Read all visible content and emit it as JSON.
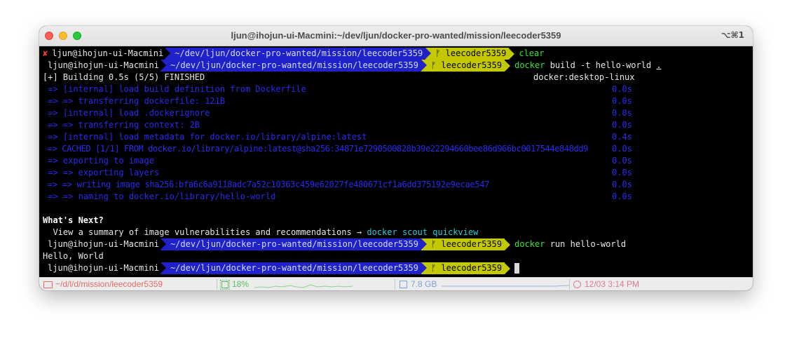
{
  "window": {
    "title": "ljun@ihojun-ui-Macmini:~/dev/ljun/docker-pro-wanted/mission/leecoder5359",
    "shortcut": "⌥⌘1"
  },
  "prompt": {
    "context": "ljun@ihojun-ui-Macmini",
    "path": "~/dev/ljun/docker-pro-wanted/mission/leecoder5359",
    "branch": "leecoder5359",
    "branch_icon": "git-branch-icon",
    "error_mark": "✘"
  },
  "lines": {
    "l1_cmd": "clear",
    "l2_cmd": "docker",
    "l2_args": " build -t hello-world ",
    "l2_dot": ".",
    "build_status": "[+] Building 0.5s (5/5) FINISHED",
    "build_platform": "docker:desktop-linux",
    "steps": [
      {
        "text": " => [internal] load build definition from Dockerfile",
        "time": "0.0s"
      },
      {
        "text": " => => transferring dockerfile: 121B",
        "time": "0.0s"
      },
      {
        "text": " => [internal] load .dockerignore",
        "time": "0.0s"
      },
      {
        "text": " => => transferring context: 2B",
        "time": "0.0s"
      },
      {
        "text": " => [internal] load metadata for docker.io/library/alpine:latest",
        "time": "0.4s"
      },
      {
        "text": " => CACHED [1/1] FROM docker.io/library/alpine:latest@sha256:34871e7290500828b39e22294660bee86d966bc0017544e848dd9",
        "time": "0.0s"
      },
      {
        "text": " => exporting to image",
        "time": "0.0s"
      },
      {
        "text": " => => exporting layers",
        "time": "0.0s"
      },
      {
        "text": " => => writing image sha256:bfa6c6a9118adc7a52c10363c459e62027fe480671cf1a6dd375192e9ecae547",
        "time": "0.0s"
      },
      {
        "text": " => => naming to docker.io/library/hello-world",
        "time": "0.0s"
      }
    ],
    "whats_next": "What's Next?",
    "summary_text": "  View a summary of image vulnerabilities and recommendations → ",
    "summary_cmd": "docker scout quickview",
    "run_cmd": "docker",
    "run_args": " run hello-world",
    "output": "Hello, World"
  },
  "statusbar": {
    "dir": "~/d/l/d/mission/leecoder5359",
    "cpu": "18%",
    "mem": "7.8 GB",
    "time": "12/03 3:14 PM"
  },
  "colors": {
    "path_bg": "#1e22c8",
    "branch_bg": "#c4c800",
    "command": "#3ce03c",
    "build_step": "#2a2af0"
  }
}
